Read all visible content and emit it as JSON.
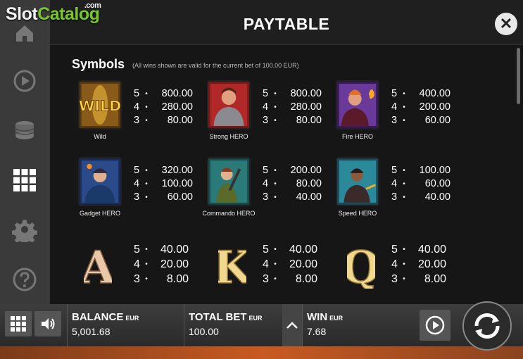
{
  "logo": {
    "part1": "Slot",
    "part2": "Catalog",
    "suffix": ".com"
  },
  "header": {
    "title": "PAYTABLE"
  },
  "section": {
    "title": "Symbols",
    "note": "(All wins shown are valid for the current bet of 100.00 EUR)"
  },
  "symbols": [
    {
      "name": "Wild",
      "pays": [
        {
          "k": "5",
          "v": "800.00"
        },
        {
          "k": "4",
          "v": "280.00"
        },
        {
          "k": "3",
          "v": "80.00"
        }
      ]
    },
    {
      "name": "Strong HERO",
      "pays": [
        {
          "k": "5",
          "v": "800.00"
        },
        {
          "k": "4",
          "v": "280.00"
        },
        {
          "k": "3",
          "v": "80.00"
        }
      ]
    },
    {
      "name": "Fire HERO",
      "pays": [
        {
          "k": "5",
          "v": "400.00"
        },
        {
          "k": "4",
          "v": "200.00"
        },
        {
          "k": "3",
          "v": "60.00"
        }
      ]
    },
    {
      "name": "Gadget HERO",
      "pays": [
        {
          "k": "5",
          "v": "320.00"
        },
        {
          "k": "4",
          "v": "100.00"
        },
        {
          "k": "3",
          "v": "60.00"
        }
      ]
    },
    {
      "name": "Commando HERO",
      "pays": [
        {
          "k": "5",
          "v": "200.00"
        },
        {
          "k": "4",
          "v": "80.00"
        },
        {
          "k": "3",
          "v": "40.00"
        }
      ]
    },
    {
      "name": "Speed HERO",
      "pays": [
        {
          "k": "5",
          "v": "100.00"
        },
        {
          "k": "4",
          "v": "60.00"
        },
        {
          "k": "3",
          "v": "40.00"
        }
      ]
    },
    {
      "glyph": "A",
      "pays": [
        {
          "k": "5",
          "v": "40.00"
        },
        {
          "k": "4",
          "v": "20.00"
        },
        {
          "k": "3",
          "v": "8.00"
        }
      ]
    },
    {
      "glyph": "K",
      "pays": [
        {
          "k": "5",
          "v": "40.00"
        },
        {
          "k": "4",
          "v": "20.00"
        },
        {
          "k": "3",
          "v": "8.00"
        }
      ]
    },
    {
      "glyph": "Q",
      "pays": [
        {
          "k": "5",
          "v": "40.00"
        },
        {
          "k": "4",
          "v": "20.00"
        },
        {
          "k": "3",
          "v": "8.00"
        }
      ]
    }
  ],
  "wild_tile_text": "WILD",
  "bottom_bar": {
    "balance": {
      "label": "BALANCE",
      "currency": "EUR",
      "value": "5,001.68"
    },
    "total_bet": {
      "label": "TOTAL BET",
      "currency": "EUR",
      "value": "100.00"
    },
    "win": {
      "label": "WIN",
      "currency": "EUR",
      "value": "7.68"
    }
  },
  "icons": [
    "home-icon",
    "autoplay-icon",
    "coins-icon",
    "paytable-grid-icon",
    "settings-gear-icon",
    "help-icon",
    "close-icon",
    "menu-grid-icon",
    "sound-icon",
    "chevron-up-icon",
    "autoplay-icon",
    "spin-icon"
  ],
  "colors": {
    "logo_green": "#79c72e",
    "panel_bg": "#161616",
    "sidebar_bg": "#3a3a3a"
  }
}
